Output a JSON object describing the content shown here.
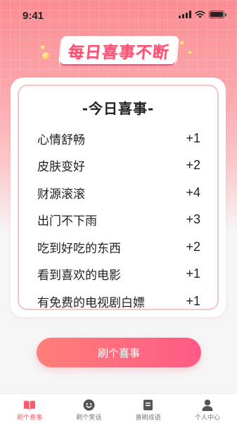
{
  "status_bar": {
    "time": "9:41"
  },
  "banner": {
    "title": "每日喜事不断"
  },
  "card": {
    "title": "-今日喜事-",
    "items": [
      {
        "text": "心情舒畅",
        "score": "+1"
      },
      {
        "text": "皮肤变好",
        "score": "+2"
      },
      {
        "text": "财源滚滚",
        "score": "+4"
      },
      {
        "text": "出门不下雨",
        "score": "+3"
      },
      {
        "text": "吃到好吃的东西",
        "score": "+2"
      },
      {
        "text": "看到喜欢的电影",
        "score": "+1"
      },
      {
        "text": "有免费的电视剧白嫖",
        "score": "+1"
      }
    ]
  },
  "cta": {
    "label": "刷个喜事"
  },
  "tabbar": {
    "tabs": [
      {
        "label": "刷个喜事",
        "icon": "book-icon",
        "active": true
      },
      {
        "label": "刷个笑话",
        "icon": "smile-icon",
        "active": false
      },
      {
        "label": "喜刷成语",
        "icon": "notebook-icon",
        "active": false
      },
      {
        "label": "个人中心",
        "icon": "user-icon",
        "active": false
      }
    ]
  },
  "colors": {
    "accent": "#ff5a6e",
    "header_gradient_top": "#fb8c92",
    "card_border": "#f4c5c7",
    "button_start": "#ff7f78",
    "button_end": "#ff5a86"
  }
}
